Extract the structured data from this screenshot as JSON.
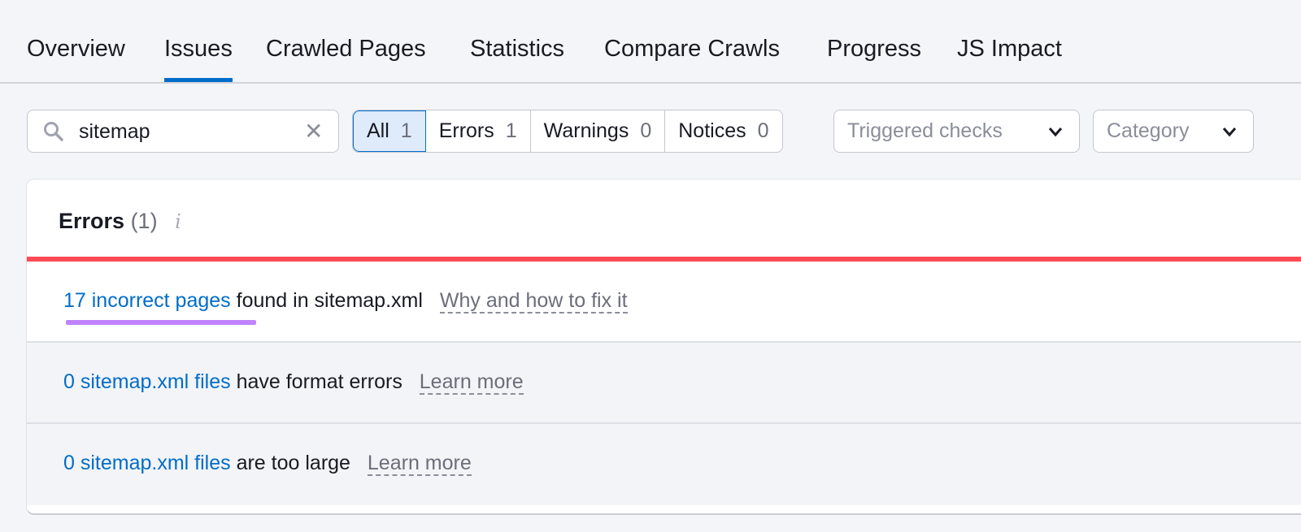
{
  "tabs": [
    {
      "label": "Overview"
    },
    {
      "label": "Issues",
      "active": true
    },
    {
      "label": "Crawled Pages"
    },
    {
      "label": "Statistics"
    },
    {
      "label": "Compare Crawls"
    },
    {
      "label": "Progress"
    },
    {
      "label": "JS Impact"
    }
  ],
  "search": {
    "value": "sitemap",
    "clear": "✕",
    "icon": "search-icon"
  },
  "filters": [
    {
      "label": "All",
      "count": "1"
    },
    {
      "label": "Errors",
      "count": "1"
    },
    {
      "label": "Warnings",
      "count": "0"
    },
    {
      "label": "Notices",
      "count": "0"
    }
  ],
  "dropdowns": {
    "checks": "Triggered checks",
    "category": "Category"
  },
  "errors": {
    "title": "Errors",
    "count": "(1)",
    "info": "i",
    "rows": [
      {
        "link": "17 incorrect pages",
        "text": "found in sitemap.xml",
        "more": "Why and how to fix it"
      },
      {
        "link": "0 sitemap.xml files",
        "text": "have format errors",
        "more": "Learn more"
      },
      {
        "link": "0 sitemap.xml files",
        "text": "are too large",
        "more": "Learn more"
      }
    ]
  },
  "colors": {
    "accent": "#006dca",
    "error": "#ff4953",
    "highlight": "#c083fb"
  }
}
